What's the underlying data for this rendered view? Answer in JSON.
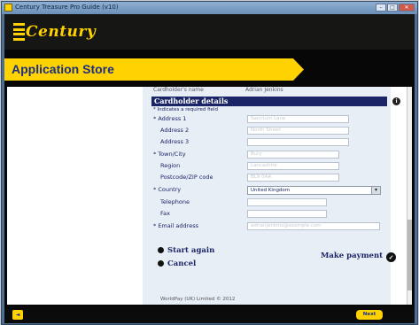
{
  "window": {
    "title": "Century Treasure Pro Guide (v10)",
    "minimize": "–",
    "maximize": "□",
    "close": "✕"
  },
  "brand": {
    "logo_text": "Century"
  },
  "header": {
    "title": "Application Store"
  },
  "form": {
    "previous_row": {
      "label": "Cardholder's name",
      "value": "Adrian Jenkins"
    },
    "section_title": "Cardholder details",
    "required_note": "* Indicates a required field",
    "fields": [
      {
        "label": "Address 1",
        "required": true,
        "value": "Sanctum Lane"
      },
      {
        "label": "Address 2",
        "required": false,
        "value": "North Street"
      },
      {
        "label": "Address 3",
        "required": false,
        "value": ""
      },
      {
        "label": "Town/City",
        "required": true,
        "value": "Bury"
      },
      {
        "label": "Region",
        "required": false,
        "value": "Lancashire"
      },
      {
        "label": "Postcode/ZIP code",
        "required": false,
        "value": "BL9 0AA"
      },
      {
        "label": "Country",
        "required": true,
        "value": "United Kingdom"
      },
      {
        "label": "Telephone",
        "required": false,
        "value": ""
      },
      {
        "label": "Fax",
        "required": false,
        "value": ""
      },
      {
        "label": "Email address",
        "required": true,
        "value": "adrianjenkins@example.com"
      }
    ],
    "start_again": "Start again",
    "cancel": "Cancel",
    "make_payment": "Make payment",
    "footer": "WorldPay (UK) Limited © 2012"
  },
  "bottom": {
    "back_label": "◄",
    "next_label": "Next"
  },
  "colors": {
    "accent_yellow": "#ffd200",
    "navy": "#1b2466",
    "frame_black": "#070707"
  }
}
